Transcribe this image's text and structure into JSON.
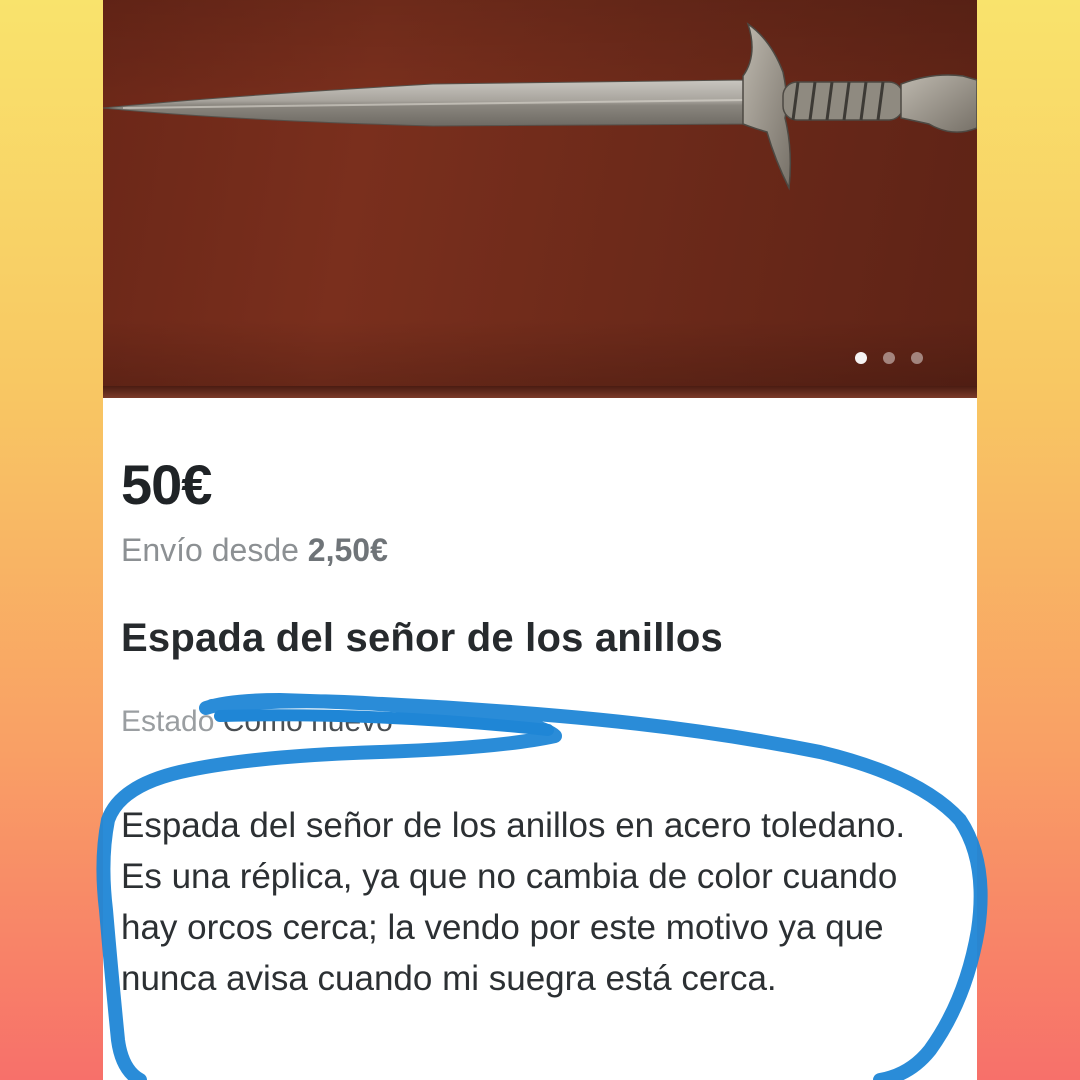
{
  "listing": {
    "price": "50€",
    "shipping_prefix": "Envío desde",
    "shipping_price": "2,50€",
    "title": "Espada del señor de los anillos",
    "condition_label": "Estado",
    "condition_value": "Como nuevo",
    "description": "Espada del señor de los anillos en acero toledano. Es una réplica, ya que no cambia de color cuando hay orcos cerca; la vendo por este motivo ya que nunca avisa cuando mi suegra está cerca."
  },
  "gallery": {
    "image_count": 3,
    "active_index": 0
  },
  "colors": {
    "highlight_stroke": "#1f86d6",
    "price_text": "#1f2326",
    "muted_text": "#8c9093"
  }
}
